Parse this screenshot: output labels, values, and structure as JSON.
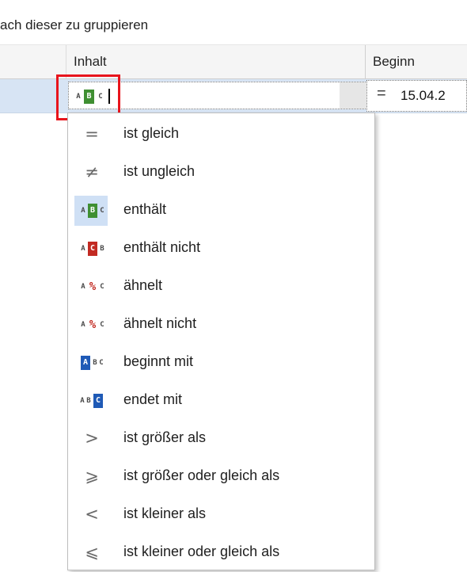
{
  "group_panel": {
    "hint": "ach dieser zu gruppieren"
  },
  "columns": [
    {
      "label": ""
    },
    {
      "label": "Inhalt"
    },
    {
      "label": "Beginn"
    }
  ],
  "filter_row": {
    "inhalt_operator_icon": "contains-abc-icon",
    "inhalt_value": "",
    "beginn_operator": "=",
    "beginn_value": "15.04.2"
  },
  "menu": {
    "items": [
      {
        "label": "ist gleich",
        "icon": "equals-icon",
        "symbol": "="
      },
      {
        "label": "ist ungleich",
        "icon": "not-equal-icon",
        "symbol": "≠"
      },
      {
        "label": "enthält",
        "icon": "contains-icon",
        "symbol": "ABC",
        "selected": true
      },
      {
        "label": "enthält nicht",
        "icon": "not-contains-icon",
        "symbol": "ACB"
      },
      {
        "label": "ähnelt",
        "icon": "like-icon",
        "symbol": "A%C"
      },
      {
        "label": "ähnelt nicht",
        "icon": "not-like-icon",
        "symbol": "A%C"
      },
      {
        "label": "beginnt mit",
        "icon": "begins-with-icon",
        "symbol": "ABC"
      },
      {
        "label": "endet mit",
        "icon": "ends-with-icon",
        "symbol": "ABC"
      },
      {
        "label": "ist größer als",
        "icon": "greater-than-icon",
        "symbol": ">"
      },
      {
        "label": "ist größer oder gleich als",
        "icon": "greater-or-equal-icon",
        "symbol": "⩾"
      },
      {
        "label": "ist kleiner als",
        "icon": "less-than-icon",
        "symbol": "<"
      },
      {
        "label": "ist kleiner oder gleich als",
        "icon": "less-or-equal-icon",
        "symbol": "⩽"
      }
    ]
  },
  "colors": {
    "selection": "#d7e4f4",
    "highlight": "#e8141c",
    "green": "#3f8f32",
    "red": "#c22a22",
    "blue": "#1f5ab6"
  }
}
